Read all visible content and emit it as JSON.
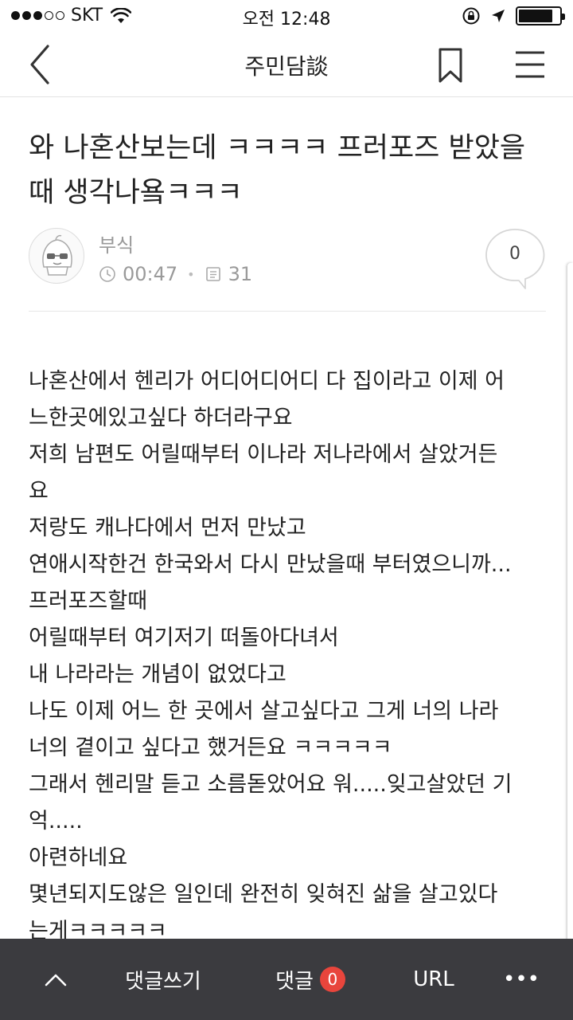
{
  "status_bar": {
    "carrier": "SKT",
    "time": "오전 12:48",
    "signal_bars_filled": 3,
    "signal_bars_total": 5
  },
  "nav": {
    "title": "주민담談",
    "back_icon": "chevron-left-icon",
    "bookmark_icon": "bookmark-icon",
    "menu_icon": "hamburger-menu-icon"
  },
  "post": {
    "title": "와 나혼산보는데 ㅋㅋㅋㅋ 프러포즈 받았을 때 생각나욬ㅋㅋㅋ",
    "author": "부식",
    "time": "00:47",
    "views": "31",
    "comment_count": "0",
    "body_lines": [
      "나혼산에서 헨리가 어디어디어디 다 집이라고 이제 어",
      "느한곳에있고싶다 하더라구요",
      "저희 남편도 어릴때부터 이나라 저나라에서 살았거든",
      "요",
      "저랑도 캐나다에서 먼저 만났고",
      "연애시작한건 한국와서 다시 만났을때 부터였으니까...",
      "프러포즈할때",
      "어릴때부터 여기저기 떠돌아다녀서",
      "내 나라라는 개념이 없었다고",
      "나도 이제 어느 한 곳에서 살고싶다고 그게 너의 나라",
      "너의 곁이고 싶다고 했거든요 ㅋㅋㅋㅋㅋ",
      "그래서 헨리말 듣고 소름돋았어요 워.....잊고살았던 기",
      "억.....",
      "아련하네요",
      "몇년되지도않은 일인데 완전히 잊혀진 삶을 살고있다",
      "는게ㅋㅋㅋㅋㅋ"
    ]
  },
  "bottom_bar": {
    "up_icon": "chevron-up-icon",
    "write_comment": "댓글쓰기",
    "comments": "댓글",
    "comments_badge": "0",
    "url": "URL",
    "more": "•••"
  },
  "colors": {
    "bottom_bar_bg": "#3b3b3f",
    "badge_bg": "#e8453c",
    "meta_text": "#9a9a9a"
  }
}
